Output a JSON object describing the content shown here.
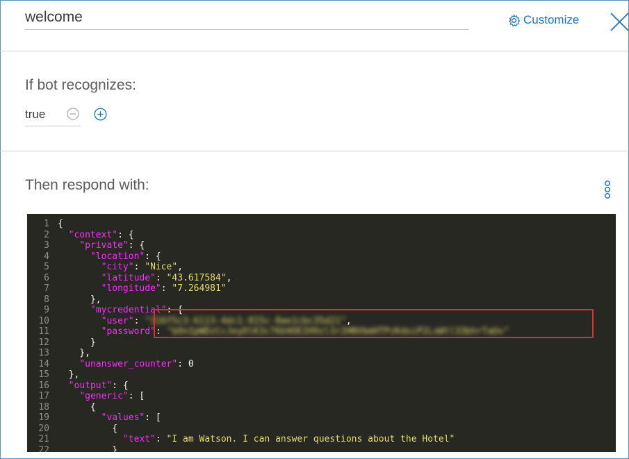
{
  "header": {
    "node_name": "welcome",
    "customize_label": "Customize"
  },
  "condition": {
    "label": "If bot recognizes:",
    "value": "true"
  },
  "response": {
    "label": "Then respond with:"
  },
  "colors": {
    "accent": "#1d72ba",
    "editor_bg": "#272822",
    "json_key": "#f92aff",
    "json_string": "#e6db74",
    "highlight_border": "#e0321e"
  },
  "editor": {
    "lines": [
      [
        {
          "t": "p",
          "v": "{"
        }
      ],
      [
        {
          "t": "p",
          "v": "  "
        },
        {
          "t": "k",
          "v": "\"context\""
        },
        {
          "t": "p",
          "v": ": {"
        }
      ],
      [
        {
          "t": "p",
          "v": "    "
        },
        {
          "t": "k",
          "v": "\"private\""
        },
        {
          "t": "p",
          "v": ": {"
        }
      ],
      [
        {
          "t": "p",
          "v": "      "
        },
        {
          "t": "k",
          "v": "\"location\""
        },
        {
          "t": "p",
          "v": ": {"
        }
      ],
      [
        {
          "t": "p",
          "v": "        "
        },
        {
          "t": "k",
          "v": "\"city\""
        },
        {
          "t": "p",
          "v": ": "
        },
        {
          "t": "s",
          "v": "\"Nice\""
        },
        {
          "t": "p",
          "v": ","
        }
      ],
      [
        {
          "t": "p",
          "v": "        "
        },
        {
          "t": "k",
          "v": "\"latitude\""
        },
        {
          "t": "p",
          "v": ": "
        },
        {
          "t": "s",
          "v": "\"43.617584\""
        },
        {
          "t": "p",
          "v": ","
        }
      ],
      [
        {
          "t": "p",
          "v": "        "
        },
        {
          "t": "k",
          "v": "\"longitude\""
        },
        {
          "t": "p",
          "v": ": "
        },
        {
          "t": "s",
          "v": "\"7.264981\""
        }
      ],
      [
        {
          "t": "p",
          "v": "      },"
        }
      ],
      [
        {
          "t": "p",
          "v": "      "
        },
        {
          "t": "k",
          "v": "\"mycredential\""
        },
        {
          "t": "p",
          "v": ": {"
        }
      ],
      [
        {
          "t": "p",
          "v": "        "
        },
        {
          "t": "k",
          "v": "\"user\""
        },
        {
          "t": "p",
          "v": ": "
        },
        {
          "t": "b",
          "v": "\"316f5c3-6113-4dc1-815c-8ae1cbc35d21\""
        },
        {
          "t": "p",
          "v": ","
        }
      ],
      [
        {
          "t": "p",
          "v": "        "
        },
        {
          "t": "k",
          "v": "\"password\""
        },
        {
          "t": "p",
          "v": ": "
        },
        {
          "t": "b",
          "v": "\"bOnIpWDzCcJeyDlK3c76U4OEIH9zl3r2HNVbmHTPzKdoiP2LxWtl33bhrTaUv\""
        }
      ],
      [
        {
          "t": "p",
          "v": "      }"
        }
      ],
      [
        {
          "t": "p",
          "v": "    },"
        }
      ],
      [
        {
          "t": "p",
          "v": "    "
        },
        {
          "t": "k",
          "v": "\"unanswer_counter\""
        },
        {
          "t": "p",
          "v": ": "
        },
        {
          "t": "n",
          "v": "0"
        }
      ],
      [
        {
          "t": "p",
          "v": "  },"
        }
      ],
      [
        {
          "t": "p",
          "v": "  "
        },
        {
          "t": "k",
          "v": "\"output\""
        },
        {
          "t": "p",
          "v": ": {"
        }
      ],
      [
        {
          "t": "p",
          "v": "    "
        },
        {
          "t": "k",
          "v": "\"generic\""
        },
        {
          "t": "p",
          "v": ": ["
        }
      ],
      [
        {
          "t": "p",
          "v": "      {"
        }
      ],
      [
        {
          "t": "p",
          "v": "        "
        },
        {
          "t": "k",
          "v": "\"values\""
        },
        {
          "t": "p",
          "v": ": ["
        }
      ],
      [
        {
          "t": "p",
          "v": "          {"
        }
      ],
      [
        {
          "t": "p",
          "v": "            "
        },
        {
          "t": "k",
          "v": "\"text\""
        },
        {
          "t": "p",
          "v": ": "
        },
        {
          "t": "s",
          "v": "\"I am Watson. I can answer questions about the Hotel\""
        }
      ],
      [
        {
          "t": "p",
          "v": "          }"
        }
      ]
    ]
  }
}
